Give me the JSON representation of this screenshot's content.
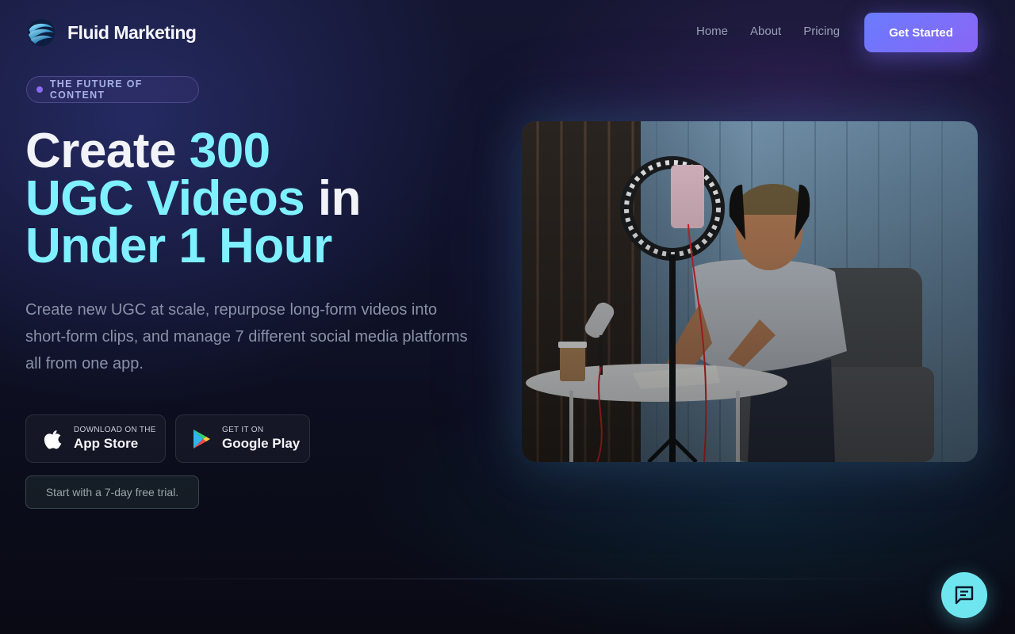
{
  "brand": {
    "name": "Fluid Marketing",
    "logo_icon": "swirl-logo-icon"
  },
  "nav": {
    "links": [
      "Home",
      "About",
      "Pricing"
    ],
    "cta_label": "Get Started"
  },
  "hero": {
    "badge": "THE FUTURE OF CONTENT",
    "headline": {
      "part1": "Create ",
      "part2": "300",
      "part3": "UGC Videos",
      "part4": " in",
      "part5": "Under 1 Hour"
    },
    "subtext": "Create new UGC at scale, repurpose long-form videos into short-form clips, and manage 7 different social media platforms all from one app.",
    "app_store": {
      "small": "Download on the",
      "big": "App Store",
      "icon": "apple-icon"
    },
    "google_play": {
      "small": "Get it on",
      "big": "Google Play",
      "icon": "google-play-icon"
    },
    "trial_text": "Start with a 7-day free trial."
  },
  "chat": {
    "icon": "chat-icon"
  },
  "colors": {
    "accent_cyan": "#7ff0ff",
    "cta_gradient_start": "#6a7cff",
    "cta_gradient_end": "#8a66f5",
    "background": "#10122a"
  }
}
